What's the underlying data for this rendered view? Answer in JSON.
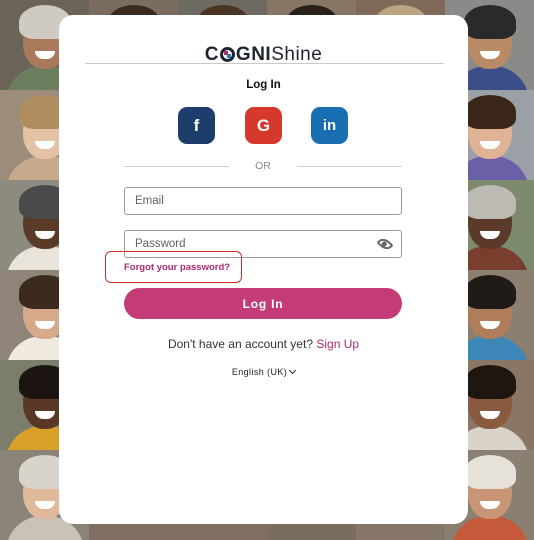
{
  "brand": {
    "logo_part1": "C",
    "logo_part2": "GNI",
    "logo_part3": "Shine"
  },
  "form": {
    "title": "Log In",
    "social": {
      "facebook_label": "f",
      "google_label": "G",
      "linkedin_label": "in"
    },
    "divider_text": "OR",
    "email_placeholder": "Email",
    "password_placeholder": "Password",
    "forgot_password": "Forgot your password?",
    "login_button": "Log In",
    "signup_prompt": "Don't have an account yet?",
    "signup_link": "Sign Up",
    "language": "English (UK)"
  },
  "colors": {
    "accent": "#c43c77",
    "facebook": "#1d3e6c",
    "google": "#d6392b",
    "linkedin": "#1a6fb3",
    "highlight": "#d52a2a"
  },
  "icons": {
    "password_toggle": "eye-icon",
    "language_dropdown": "chevron-down-icon"
  }
}
